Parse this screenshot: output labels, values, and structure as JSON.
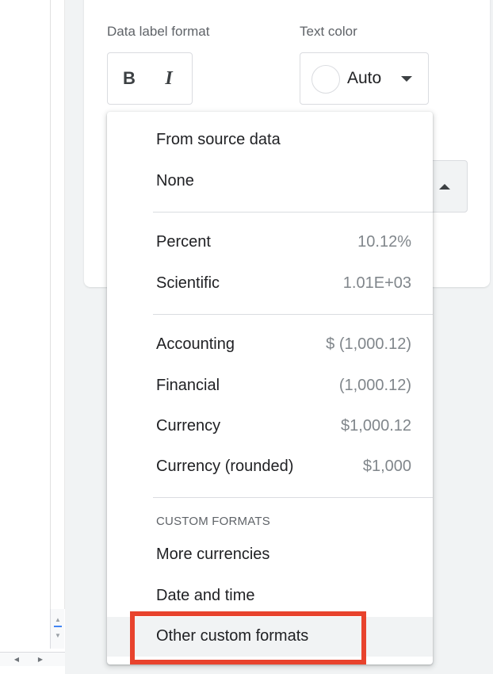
{
  "editor": {
    "format_label": "Data label format",
    "color_label": "Text color",
    "bold_glyph": "B",
    "italic_glyph": "I",
    "color_value": "Auto"
  },
  "menu": {
    "items": [
      {
        "name": "From source data",
        "example": ""
      },
      {
        "name": "None",
        "example": ""
      },
      {
        "name": "Percent",
        "example": "10.12%"
      },
      {
        "name": "Scientific",
        "example": "1.01E+03"
      },
      {
        "name": "Accounting",
        "example": "$ (1,000.12)"
      },
      {
        "name": "Financial",
        "example": "(1,000.12)"
      },
      {
        "name": "Currency",
        "example": "$1,000.12"
      },
      {
        "name": "Currency (rounded)",
        "example": "$1,000"
      }
    ],
    "custom_header": "CUSTOM FORMATS",
    "custom_items": [
      {
        "name": "More currencies"
      },
      {
        "name": "Date and time"
      },
      {
        "name": "Other custom formats"
      }
    ]
  },
  "icons": {
    "scroll_up": "▲",
    "scroll_down": "▼",
    "scroll_left": "◀",
    "scroll_right": "▶"
  },
  "colors": {
    "highlight_box": "#e8432d",
    "panel_bg": "#f1f3f4",
    "menu_bg": "#ffffff"
  }
}
